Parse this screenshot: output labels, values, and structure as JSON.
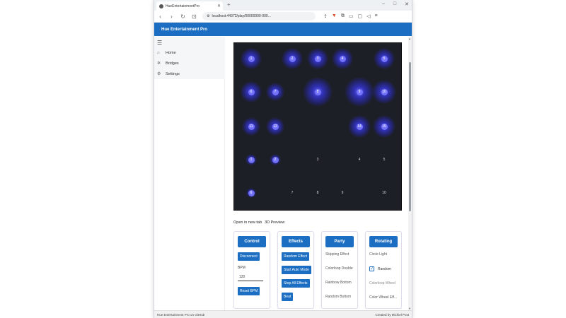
{
  "browser": {
    "tab_title": "HueEntertainmentPro",
    "new_tab": "+",
    "url": "localhost:44372/play/00000000-000...",
    "window_controls": [
      "–",
      "□",
      "✕"
    ]
  },
  "app": {
    "title": "Hue Entertainment Pro",
    "accent": "#1b6ec2"
  },
  "sidebar": {
    "menu_icon": "hamburger-icon",
    "items": [
      {
        "label": "Home",
        "icon": "home-icon"
      },
      {
        "label": "Bridges",
        "icon": "bridge-icon"
      },
      {
        "label": "Settings",
        "icon": "gear-icon"
      }
    ]
  },
  "preview": {
    "lights": [
      {
        "id": "1",
        "lit": true
      },
      {
        "id": "2",
        "lit": true
      },
      {
        "id": "3",
        "lit": true
      },
      {
        "id": "4",
        "lit": true
      },
      {
        "id": "5",
        "lit": true
      },
      {
        "id": "6",
        "lit": true
      },
      {
        "id": "7",
        "lit": true
      },
      {
        "id": "8",
        "lit": true
      },
      {
        "id": "9",
        "lit": true
      },
      {
        "id": "10",
        "lit": true
      },
      {
        "id": "11",
        "lit": true
      },
      {
        "id": "12",
        "lit": true
      },
      {
        "id": "14",
        "lit": true
      },
      {
        "id": "15",
        "lit": true
      },
      {
        "id": "1",
        "lit": true
      },
      {
        "id": "2",
        "lit": true
      },
      {
        "id": "3",
        "lit": false
      },
      {
        "id": "4",
        "lit": false
      },
      {
        "id": "5",
        "lit": false
      },
      {
        "id": "6",
        "lit": true
      },
      {
        "id": "7",
        "lit": false
      },
      {
        "id": "8",
        "lit": false
      },
      {
        "id": "9",
        "lit": false
      },
      {
        "id": "10",
        "lit": false
      }
    ]
  },
  "links": {
    "open_new_tab": "Open in new tab",
    "preview_3d": "3D Preview"
  },
  "cards": {
    "control": {
      "title": "Control",
      "disconnect": "Disconnect",
      "bpm_label": "BPM",
      "bpm_value": "120",
      "reset_bpm": "Reset BPM"
    },
    "effects": {
      "title": "Effects",
      "random_effect": "Random Effect",
      "start_auto_mode": "Start Auto Mode",
      "stop_all_effects": "Stop All Effects",
      "beat": "Beat"
    },
    "party": {
      "title": "Party",
      "options": [
        "Skipping Effect",
        "Colorloop Double",
        "Rainbow Bottom",
        "Random Bottom"
      ]
    },
    "rotating": {
      "title": "Rotating",
      "options": [
        "Circle Light",
        "Random",
        "Colorloop Wheel",
        "Color Wheel Eff..."
      ]
    }
  },
  "footer": {
    "left": "Hue Entertainment Pro on GitHub",
    "right": "Created by Michiel Post"
  }
}
